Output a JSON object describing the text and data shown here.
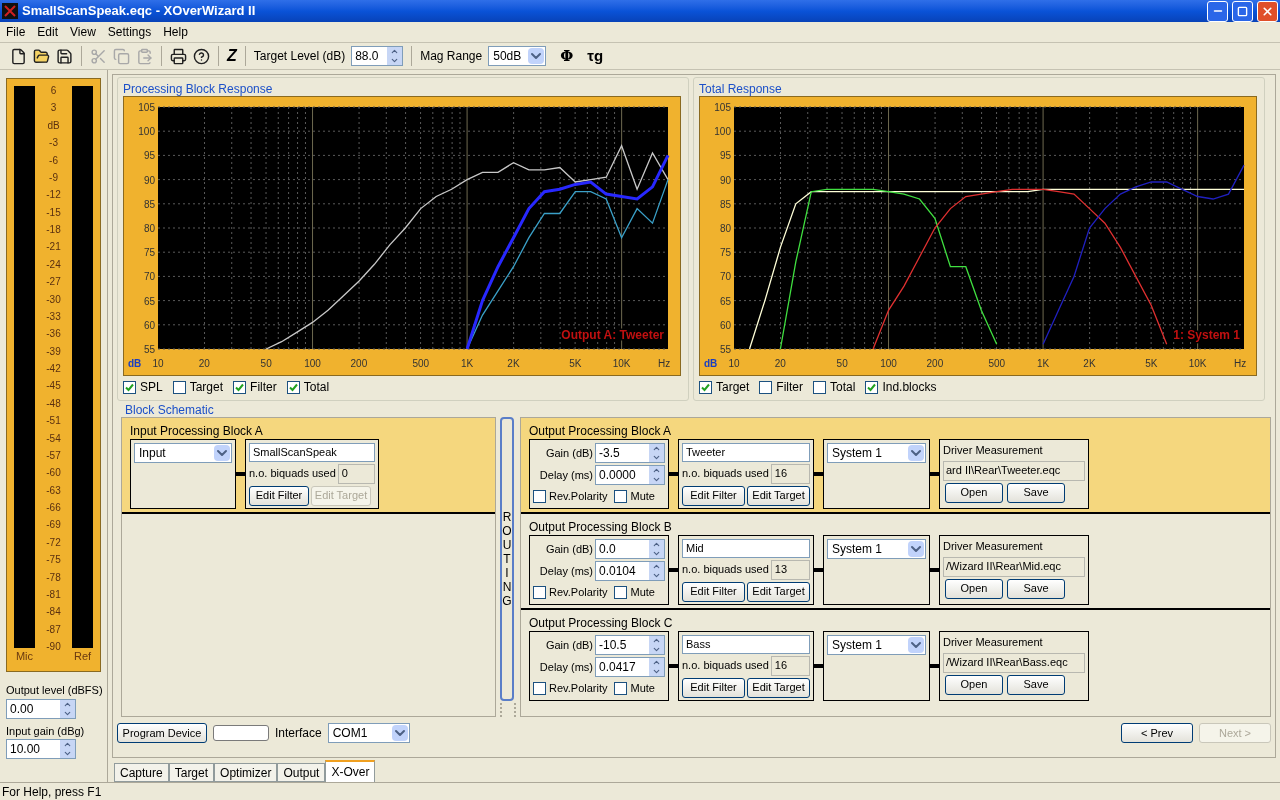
{
  "window": {
    "title": "SmallScanSpeak.eqc - XOverWizard II"
  },
  "menu": [
    "File",
    "Edit",
    "View",
    "Settings",
    "Help"
  ],
  "toolbar": {
    "buttons": [
      {
        "kind": "new",
        "disabled": false
      },
      {
        "kind": "open",
        "disabled": false
      },
      {
        "kind": "save",
        "disabled": false
      },
      {
        "kind": "cut",
        "disabled": true
      },
      {
        "kind": "copy",
        "disabled": true
      },
      {
        "kind": "paste",
        "disabled": true
      },
      {
        "kind": "print",
        "disabled": false
      },
      {
        "kind": "help",
        "disabled": false
      }
    ],
    "z_button": "Z",
    "target_level_label": "Target Level (dB)",
    "target_level_value": "88.0",
    "mag_range_label": "Mag Range",
    "mag_range_value": "50dB",
    "phase_button": "Φ",
    "group_delay_button": "τg"
  },
  "meter": {
    "scale": [
      "6",
      "3",
      "dB",
      "-3",
      "-6",
      "-9",
      "-12",
      "-15",
      "-18",
      "-21",
      "-24",
      "-27",
      "-30",
      "-33",
      "-36",
      "-39",
      "-42",
      "-45",
      "-48",
      "-51",
      "-54",
      "-57",
      "-60",
      "-63",
      "-66",
      "-69",
      "-72",
      "-75",
      "-78",
      "-81",
      "-84",
      "-87",
      "-90"
    ],
    "left_label": "Mic",
    "right_label": "Ref"
  },
  "output_level": {
    "label": "Output level (dBFS)",
    "value": "0.00"
  },
  "input_gain": {
    "label": "Input gain (dBg)",
    "value": "10.00"
  },
  "charts": [
    {
      "title": "Processing Block Response",
      "chart_data": {
        "type": "line",
        "xlabel": "Hz",
        "ylabel": "dB",
        "categories": [
          "10",
          null,
          null,
          "20",
          null,
          null,
          null,
          "50",
          null,
          null,
          "100",
          null,
          null,
          "200",
          null,
          null,
          null,
          "500",
          null,
          null,
          "1K",
          null,
          null,
          "2K",
          null,
          null,
          null,
          "5K",
          null,
          null,
          "10K",
          null,
          null,
          null
        ],
        "ylim": [
          55,
          105
        ],
        "grid": true,
        "yticks": [
          55,
          60,
          65,
          70,
          75,
          80,
          85,
          90,
          95,
          100,
          105
        ],
        "series": [
          {
            "color": "#c8c8c8",
            "values": [
              null,
              null,
              null,
              null,
              null,
              null,
              null,
              55,
              56.5,
              58.5,
              60.5,
              63,
              66,
              69,
              72.5,
              76.5,
              80,
              84,
              86.5,
              88,
              90,
              91.5,
              91.5,
              93.5,
              92,
              92,
              92.5,
              89.5,
              90,
              90.5,
              97,
              88,
              95.5,
              90
            ]
          },
          {
            "color": "#3aa0c8",
            "values": [
              null,
              null,
              null,
              null,
              null,
              null,
              null,
              null,
              null,
              null,
              null,
              null,
              null,
              null,
              null,
              null,
              null,
              null,
              null,
              null,
              55,
              62,
              67,
              72,
              78,
              83,
              83,
              87.5,
              87.5,
              86,
              78,
              84,
              81,
              90
            ]
          },
          {
            "color": "#2828ff",
            "values": [
              null,
              null,
              null,
              null,
              null,
              null,
              null,
              null,
              null,
              null,
              null,
              null,
              null,
              null,
              null,
              null,
              null,
              null,
              null,
              null,
              55,
              65,
              72,
              78,
              84,
              87.5,
              88,
              89,
              89.5,
              87,
              86.5,
              86,
              88.5,
              95
            ]
          }
        ],
        "annotations": [
          {
            "text": "Output A: Tweeter"
          }
        ]
      },
      "checkboxes": [
        {
          "label": "SPL",
          "checked": true
        },
        {
          "label": "Target",
          "checked": false
        },
        {
          "label": "Filter",
          "checked": true
        },
        {
          "label": "Total",
          "checked": true
        }
      ]
    },
    {
      "title": "Total Response",
      "chart_data": {
        "type": "line",
        "xlabel": "Hz",
        "ylabel": "dB",
        "categories": [
          "10",
          null,
          null,
          "20",
          null,
          null,
          null,
          "50",
          null,
          null,
          "100",
          null,
          null,
          "200",
          null,
          null,
          null,
          "500",
          null,
          null,
          "1K",
          null,
          null,
          "2K",
          null,
          null,
          null,
          "5K",
          null,
          null,
          "10K",
          null,
          null,
          null
        ],
        "ylim": [
          55,
          105
        ],
        "grid": true,
        "yticks": [
          55,
          60,
          65,
          70,
          75,
          80,
          85,
          90,
          95,
          100,
          105
        ],
        "series": [
          {
            "color": "#ffffd8",
            "values": [
              null,
              55,
              65,
              76,
              85,
              87.5,
              87.5,
              87.5,
              87.5,
              87.5,
              87.5,
              87.5,
              87.5,
              87.5,
              87.5,
              87.5,
              87.5,
              87.5,
              87.5,
              87.5,
              88,
              88,
              88,
              88,
              88,
              88,
              88,
              88,
              88,
              88,
              88,
              88,
              88,
              88
            ]
          },
          {
            "color": "#40e040",
            "values": [
              null,
              null,
              null,
              55,
              73,
              87.5,
              88,
              88,
              88,
              88,
              87.5,
              87,
              86,
              82,
              72,
              72,
              63,
              56,
              null,
              null,
              null,
              null,
              null,
              null,
              null,
              null,
              null,
              null,
              null,
              null,
              null,
              null,
              null,
              null
            ]
          },
          {
            "color": "#e03030",
            "values": [
              null,
              null,
              null,
              null,
              null,
              null,
              null,
              null,
              null,
              55,
              63,
              68,
              74,
              80,
              84,
              86.5,
              87,
              87.5,
              88,
              88,
              88,
              87.5,
              87,
              84,
              81,
              76,
              70,
              64,
              56,
              null,
              null,
              null,
              null,
              null
            ]
          },
          {
            "color": "#2020c0",
            "values": [
              null,
              null,
              null,
              null,
              null,
              null,
              null,
              null,
              null,
              null,
              null,
              null,
              null,
              null,
              null,
              null,
              null,
              null,
              null,
              null,
              56,
              63,
              70,
              80,
              84,
              87,
              88.5,
              89.5,
              89.5,
              88,
              86.5,
              86,
              87,
              93
            ]
          }
        ],
        "annotations": [
          {
            "text": "1: System 1"
          }
        ]
      },
      "checkboxes": [
        {
          "label": "Target",
          "checked": true
        },
        {
          "label": "Filter",
          "checked": false
        },
        {
          "label": "Total",
          "checked": false
        },
        {
          "label": "Ind.blocks",
          "checked": true
        }
      ]
    }
  ],
  "block_schematic": {
    "title": "Block Schematic",
    "input_block": {
      "title": "Input Processing Block A",
      "selected": true,
      "source": "Input",
      "name": "SmallScanSpeak",
      "biquads_label": "n.o. biquads used",
      "biquads": "0",
      "edit_filter": {
        "label": "Edit Filter",
        "disabled": false
      },
      "edit_target": {
        "label": "Edit Target",
        "disabled": true
      }
    },
    "routing": "ROUTING",
    "output_blocks": [
      {
        "title": "Output Processing Block A",
        "selected": true,
        "gain_label": "Gain (dB)",
        "gain": "-3.5",
        "delay_label": "Delay (ms)",
        "delay": "0.0000",
        "rev_polarity": {
          "label": "Rev.Polarity",
          "checked": false
        },
        "mute": {
          "label": "Mute",
          "checked": false
        },
        "name": "Tweeter",
        "biquads_label": "n.o. biquads used",
        "biquads": "16",
        "edit_filter": "Edit Filter",
        "edit_target": "Edit Target",
        "system": "System 1",
        "measurement_label": "Driver Measurement",
        "measurement_path": "ard II\\Rear\\Tweeter.eqc",
        "open": "Open",
        "save": "Save"
      },
      {
        "title": "Output Processing Block B",
        "selected": false,
        "gain_label": "Gain (dB)",
        "gain": "0.0",
        "delay_label": "Delay (ms)",
        "delay": "0.0104",
        "rev_polarity": {
          "label": "Rev.Polarity",
          "checked": false
        },
        "mute": {
          "label": "Mute",
          "checked": false
        },
        "name": "Mid",
        "biquads_label": "n.o. biquads used",
        "biquads": "13",
        "edit_filter": "Edit Filter",
        "edit_target": "Edit Target",
        "system": "System 1",
        "measurement_label": "Driver Measurement",
        "measurement_path": "/Wizard II\\Rear\\Mid.eqc",
        "open": "Open",
        "save": "Save"
      },
      {
        "title": "Output Processing Block C",
        "selected": false,
        "gain_label": "Gain (dB)",
        "gain": "-10.5",
        "delay_label": "Delay (ms)",
        "delay": "0.0417",
        "rev_polarity": {
          "label": "Rev.Polarity",
          "checked": false
        },
        "mute": {
          "label": "Mute",
          "checked": false
        },
        "name": "Bass",
        "biquads_label": "n.o. biquads used",
        "biquads": "16",
        "edit_filter": "Edit Filter",
        "edit_target": "Edit Target",
        "system": "System 1",
        "measurement_label": "Driver Measurement",
        "measurement_path": "/Wizard II\\Rear\\Bass.eqc",
        "open": "Open",
        "save": "Save"
      }
    ]
  },
  "bottom_bar": {
    "program_device": "Program Device",
    "interface_label": "Interface",
    "interface_value": "COM1",
    "prev": {
      "label": "< Prev",
      "disabled": false
    },
    "next": {
      "label": "Next >",
      "disabled": true
    }
  },
  "tabs": [
    {
      "label": "Capture",
      "selected": false
    },
    {
      "label": "Target",
      "selected": false
    },
    {
      "label": "Optimizer",
      "selected": false
    },
    {
      "label": "Output",
      "selected": false
    },
    {
      "label": "X-Over",
      "selected": true
    }
  ],
  "status_bar": "For Help, press F1"
}
